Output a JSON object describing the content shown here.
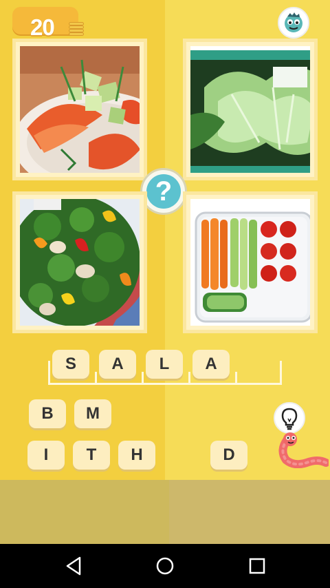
{
  "header": {
    "coins": "20",
    "coin_icon": "coin-stack-icon",
    "mascot_icon": "mascot-face-icon"
  },
  "puzzle": {
    "images": [
      {
        "name": "photo-tomato-cucumber-salad"
      },
      {
        "name": "photo-lettuce"
      },
      {
        "name": "photo-broccoli-pepper-salad"
      },
      {
        "name": "photo-vegetable-sticks-box"
      }
    ],
    "question_mark": "?"
  },
  "answer": {
    "slots": [
      "S",
      "A",
      "L",
      "A",
      ""
    ]
  },
  "letter_bank": {
    "letters": [
      "B",
      "M",
      "I",
      "T",
      "H",
      "D"
    ]
  },
  "hint": {
    "icon": "lightbulb-icon",
    "helper": "worm-mascot-icon"
  },
  "colors": {
    "background_left": "#f3cf3f",
    "background_right": "#f6dc57",
    "tile": "#fdeec0",
    "accent": "#5cc2cf",
    "coin_box": "#f5b93a"
  }
}
